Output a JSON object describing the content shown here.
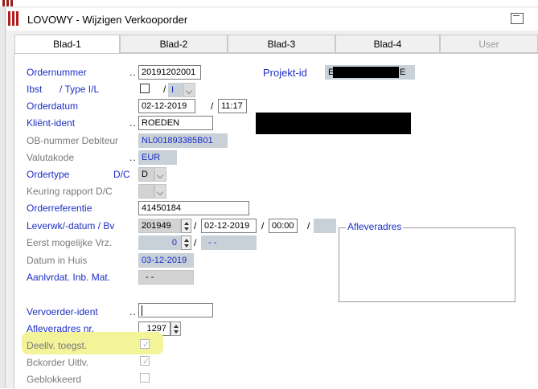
{
  "window": {
    "title": "LOVOWY - Wijzigen Verkooporder"
  },
  "tabs": [
    "Blad-1",
    "Blad-2",
    "Blad-3",
    "Blad-4",
    "User"
  ],
  "labels": {
    "ordernummer": "Ordernummer",
    "ibst": "Ibst",
    "type": "/ Type I/L",
    "orderdatum": "Orderdatum",
    "klient": "Kliënt-ident",
    "ob_nummer": "OB-nummer Debiteur",
    "valutakode": "Valutakode",
    "ordertype": "Ordertype",
    "dc": "D/C",
    "keuring": "Keuring rapport D/C",
    "orderreferentie": "Orderreferentie",
    "leverwk": "Leverwk/-datum / Bv",
    "eerst": "Eerst mogelijke Vrz.",
    "datum_in_huis": "Datum in Huis",
    "aanlvrdat": "Aanlvrdat. Inb. Mat.",
    "vervoerder": "Vervoerder-ident",
    "afleveradres_nr": "Afleveradres nr.",
    "deellv": "Deellv. toegst.",
    "backorder": "Bckorder Uitlv.",
    "geblokkeerd": "Geblokkeerd",
    "projekt_id": "Projekt-id",
    "afleveradres": "Afleveradres"
  },
  "dots": "..",
  "slash": "/",
  "values": {
    "ordernummer": "20191202001",
    "type": "I",
    "orderdatum": "02-12-2019",
    "ordertijd": "11:17",
    "klient": "ROEDEN",
    "ob_nummer": "NL001893385B01",
    "valutakode": "EUR",
    "ordertype": "D",
    "orderreferentie": "41450184",
    "leverweek": "201949",
    "leverdatum": "02-12-2019",
    "levertijd": "00:00",
    "eerst": "0",
    "eerst_datum": "- -",
    "datum_in_huis": "03-12-2019",
    "aanlvrdat": "- -",
    "afleveradres_nr": "1297",
    "projekt_id_start": "E",
    "projekt_id_end": "E"
  },
  "checkboxes": {
    "ibst": false,
    "deellv": true,
    "backorder": true,
    "geblokkeerd": false
  },
  "colors": {
    "label_blue": "#1d2fc4",
    "readonly_bg": "#c8d0d8",
    "highlight": "#f3f39a",
    "redaction": "#000000"
  }
}
